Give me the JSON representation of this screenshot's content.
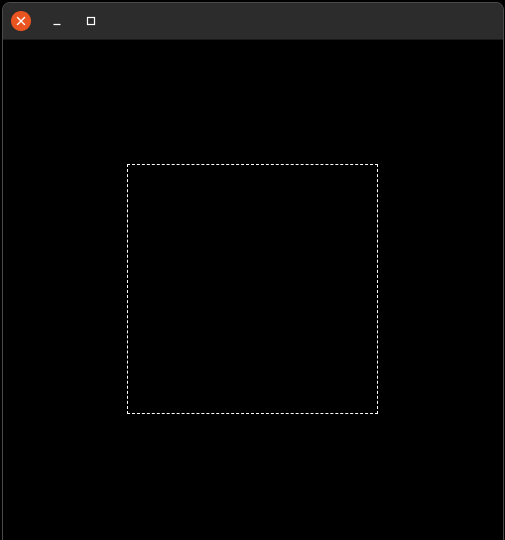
{
  "window": {
    "title": "",
    "controls": {
      "close_icon": "close-icon",
      "minimize_icon": "minimize-icon",
      "maximize_icon": "maximize-icon",
      "close_color": "#e95420"
    }
  },
  "colors": {
    "titlebar": "#2c2c2c",
    "canvas": "#000000",
    "focus_rect_border": "#ffffff"
  }
}
